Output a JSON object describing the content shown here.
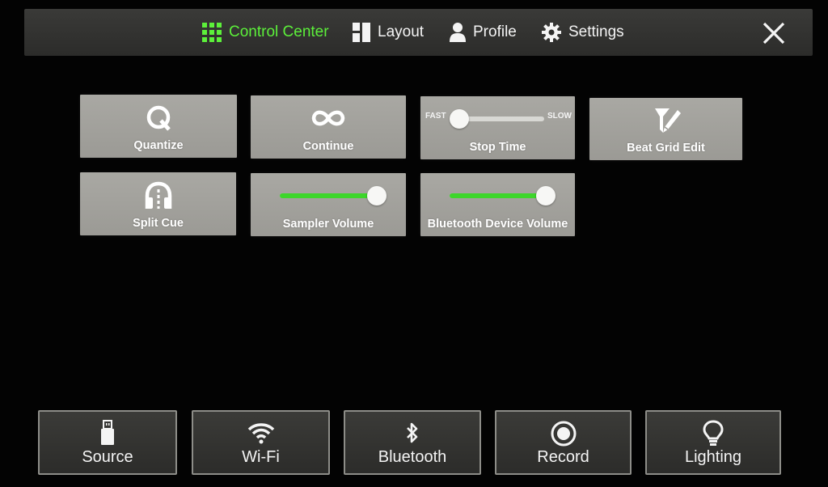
{
  "nav": {
    "items": [
      {
        "label": "Control Center",
        "icon": "grid-icon",
        "active": true
      },
      {
        "label": "Layout",
        "icon": "layout-icon",
        "active": false
      },
      {
        "label": "Profile",
        "icon": "person-icon",
        "active": false
      },
      {
        "label": "Settings",
        "icon": "gear-icon",
        "active": false
      }
    ],
    "close_icon": "close-icon"
  },
  "tiles": {
    "quantize": {
      "label": "Quantize",
      "icon": "q-icon"
    },
    "continue": {
      "label": "Continue",
      "icon": "infinity-icon"
    },
    "stop_time": {
      "label": "Stop Time",
      "fast_label": "FAST",
      "slow_label": "SLOW",
      "value": 0
    },
    "beat_grid_edit": {
      "label": "Beat Grid Edit",
      "icon": "grid-pen-icon"
    },
    "split_cue": {
      "label": "Split Cue",
      "icon": "headphone-split-icon"
    },
    "sampler_volume": {
      "label": "Sampler Volume",
      "value": 1.0
    },
    "bluetooth_device_volume": {
      "label": "Bluetooth Device Volume",
      "value": 1.0
    }
  },
  "bottom": {
    "items": [
      {
        "label": "Source",
        "icon": "usb-icon"
      },
      {
        "label": "Wi-Fi",
        "icon": "wifi-icon"
      },
      {
        "label": "Bluetooth",
        "icon": "bluetooth-icon"
      },
      {
        "label": "Record",
        "icon": "record-icon"
      },
      {
        "label": "Lighting",
        "icon": "bulb-icon"
      }
    ]
  },
  "colors": {
    "accent": "#5cf03a",
    "slider_fill": "#3dd62b"
  }
}
